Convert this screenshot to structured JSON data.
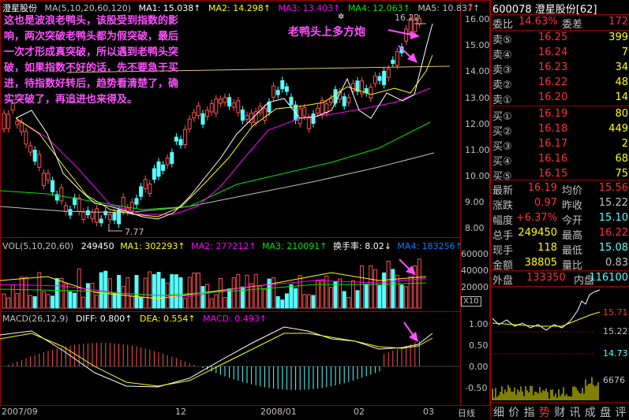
{
  "stock": {
    "name": "澄星股份",
    "code": "600078",
    "panel_title": "600078 澄星股份[62]"
  },
  "annotation": {
    "paragraph": "这也是波浪老鸭头，该股受到指数的影响，两次突破老鸭头都为假突破，最后一次才形成真突破，所以遇到老鸭头突破，如果指数不好的话，先不要急于买进，待指数好转后，趋势看清楚了，确实突破了，再追进也来得及。",
    "lines": [
      "这也是波浪老鸭头，该股受到指数的影",
      "响，两次突破老鸭头都为假突破，最后",
      "一次才形成真突破，所以遇到老鸭头突",
      "破，如果指数不好的话，先不要急于买",
      "进，待指数好转后，趋势看清楚了，确",
      "实突破了，再追进也来得及。"
    ],
    "arrow_label": "老鸭头上多方炮"
  },
  "main_chart": {
    "ma_label": "MA(5,10,20,60,120)",
    "ma1": "MA1: 15.038↑",
    "ma2": "MA2: 14.298↑",
    "ma3": "MA3: 13.403↑",
    "ma4": "MA4: 12.063↑",
    "ma5": "MA5: 10.837↑",
    "high_mark": "16.22",
    "low_mark": "7.77",
    "y_ticks": [
      "16.00",
      "15.00",
      "14.00",
      "13.00",
      "12.00",
      "11.00",
      "10.00",
      "9.00",
      "8.00"
    ]
  },
  "volume_chart": {
    "label": "VOL(5,10,20,60)",
    "value": "249450",
    "ma1": "MA1: 302293↑",
    "ma2": "MA2: 277212↑",
    "ma3": "MA3: 210091↑",
    "turnover": "换手率: 8.02↓",
    "ma4": "MA4: 183256↑",
    "y_ticks": [
      "60000",
      "40000",
      "20000"
    ],
    "unit": "X10"
  },
  "macd_chart": {
    "label": "MACD(26,12,9)",
    "diff": "DIFF: 0.800↑",
    "dea": "DEA: 0.554↑",
    "macd": "MACD: 0.493↑",
    "y_ticks": [
      "1.00",
      "0.50",
      "0.00",
      "-0.50"
    ]
  },
  "x_axis": {
    "labels": [
      "2007/09",
      "12",
      "2008/01",
      "02",
      "03"
    ],
    "period": "日线"
  },
  "order_book": {
    "weibi_label": "委比",
    "weibi": "14.63%",
    "weicha_label": "委差",
    "weicha": "172",
    "asks": [
      {
        "label": "卖⑤",
        "price": "16.25",
        "vol": "399"
      },
      {
        "label": "卖④",
        "price": "16.24",
        "vol": "7"
      },
      {
        "label": "卖③",
        "price": "16.23",
        "vol": "34"
      },
      {
        "label": "卖②",
        "price": "16.22",
        "vol": "48"
      },
      {
        "label": "卖①",
        "price": "16.20",
        "vol": "14"
      }
    ],
    "bids": [
      {
        "label": "买①",
        "price": "16.19",
        "vol": "80"
      },
      {
        "label": "买②",
        "price": "16.18",
        "vol": "449"
      },
      {
        "label": "买③",
        "price": "16.17",
        "vol": "2"
      },
      {
        "label": "买④",
        "price": "16.16",
        "vol": "68"
      },
      {
        "label": "买⑤",
        "price": "16.15",
        "vol": "75"
      }
    ]
  },
  "stats": {
    "latest_label": "最新",
    "latest": "16.19",
    "avg_label": "均价",
    "avg": "15.56",
    "change_label": "涨跌",
    "change": "0.97",
    "prev_label": "昨收",
    "prev": "15.22",
    "pct_label": "幅度",
    "pct": "+6.37%",
    "open_label": "今开",
    "open": "15.10",
    "total_label": "总手",
    "total": "249450",
    "high_label": "最高",
    "high": "16.22",
    "now_label": "现手",
    "now": "118",
    "low_label": "最低",
    "low": "15.08",
    "amount_label": "金额",
    "amount": "38805",
    "ratio_label": "量比",
    "ratio": "0.83",
    "outer_label": "外盘",
    "outer": "133350",
    "inner_label": "内盘",
    "inner": "116100"
  },
  "mini_chart": {
    "y_top": "15.71",
    "y_mid": "15.22",
    "y_bot": "14.73",
    "vol": "6676"
  },
  "bottom_tabs": [
    "细",
    "价",
    "指",
    "势",
    "财",
    "讯",
    "成",
    "盘",
    "评"
  ],
  "colors": {
    "up": "#ff5050",
    "down": "#54ffff",
    "ma1": "#ffffff",
    "ma2": "#ffff00",
    "ma3": "#ff00ff",
    "ma4": "#00e600",
    "ma5": "#c0c0c0",
    "pink": "#ff50ff",
    "frame": "#a00000"
  }
}
